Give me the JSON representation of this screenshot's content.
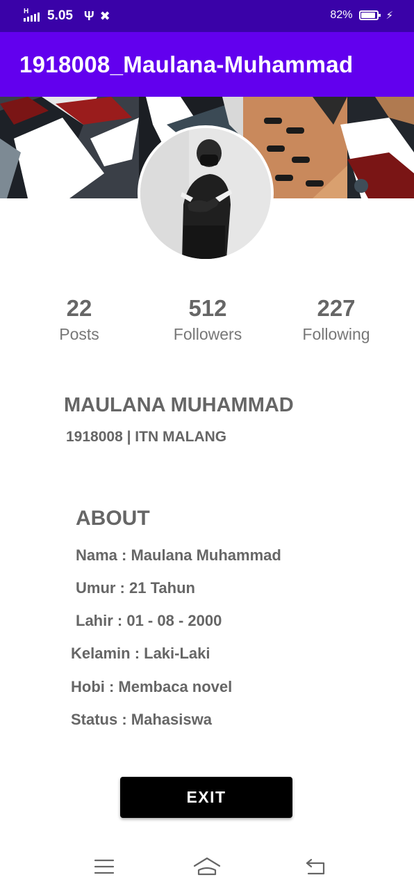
{
  "status_bar": {
    "network_type": "H",
    "time": "5.05",
    "battery_percent": "82%",
    "battery_level": 0.82,
    "icons": [
      "signal-icon",
      "usb-icon",
      "tools-icon",
      "battery-icon",
      "charging-icon"
    ]
  },
  "app_bar": {
    "title": "1918008_Maulana-Muhammad"
  },
  "stats": [
    {
      "value": "22",
      "label": "Posts"
    },
    {
      "value": "512",
      "label": "Followers"
    },
    {
      "value": "227",
      "label": "Following"
    }
  ],
  "profile": {
    "name": "MAULANA MUHAMMAD",
    "subtitle": "1918008 | ITN MALANG"
  },
  "about": {
    "title": "ABOUT",
    "items": [
      "Nama : Maulana Muhammad",
      "Umur : 21 Tahun",
      "Lahir : 01 - 08 - 2000",
      "Kelamin : Laki-Laki",
      "Hobi : Membaca novel",
      "Status : Mahasiswa"
    ]
  },
  "exit_button": {
    "label": "EXIT"
  },
  "nav_bar": {
    "icons": [
      "menu-icon",
      "home-icon",
      "back-icon"
    ]
  },
  "colors": {
    "status_bar": "#3a02a8",
    "app_bar": "#6200ee",
    "text": "#666666",
    "button": "#000000"
  }
}
